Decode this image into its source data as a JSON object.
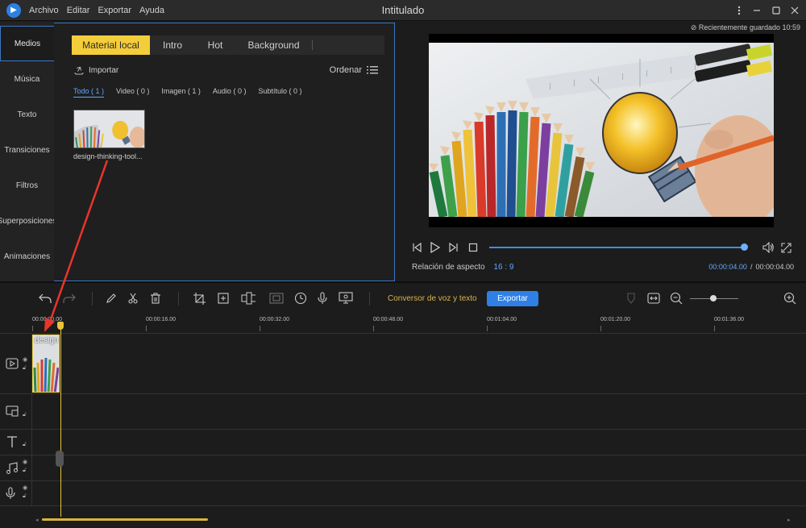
{
  "titlebar": {
    "logo": "app-logo",
    "menus": [
      "Archivo",
      "Editar",
      "Exportar",
      "Ayuda"
    ],
    "title": "Intitulado"
  },
  "left_nav": {
    "items": [
      "Medios",
      "Música",
      "Texto",
      "Transiciones",
      "Filtros",
      "Superposiciones",
      "Animaciones"
    ],
    "active": "Medios"
  },
  "media": {
    "tabs": [
      "Material local",
      "Intro",
      "Hot",
      "Background"
    ],
    "active_tab": "Material local",
    "import_label": "Importar",
    "order_label": "Ordenar",
    "filters": [
      "Todo ( 1 )",
      "Video ( 0 )",
      "Imagen ( 1 )",
      "Audio ( 0 )",
      "Subtítulo ( 0 )"
    ],
    "active_filter": "Todo ( 1 )",
    "items": [
      {
        "name": "design-thinking-tool..."
      }
    ]
  },
  "preview": {
    "saved_status": "Recientemente guardado 10:59",
    "aspect_label": "Relación de aspecto",
    "aspect_value": "16 : 9",
    "time_current": "00:00:04.00",
    "time_separator": "/",
    "time_total": "00:00:04.00",
    "progress": 1.0
  },
  "toolbar": {
    "tts_label": "Conversor de voz y texto",
    "export_label": "Exportar",
    "zoom_level": 0.45
  },
  "timeline": {
    "ticks": [
      "00:00:00.00",
      "00:00:16.00",
      "00:00:32.00",
      "00:00:48.00",
      "00:01:04.00",
      "00:01:20.00",
      "00:01:36.00"
    ],
    "clip_label": "design",
    "tracks": [
      "video-track",
      "overlay-track",
      "text-track",
      "music-track",
      "voice-track"
    ]
  },
  "colors": {
    "accent_blue": "#2f80e4",
    "accent_yellow": "#f4cd3a",
    "panel_border": "#3a78c2",
    "annotation_red": "#e8352b"
  }
}
